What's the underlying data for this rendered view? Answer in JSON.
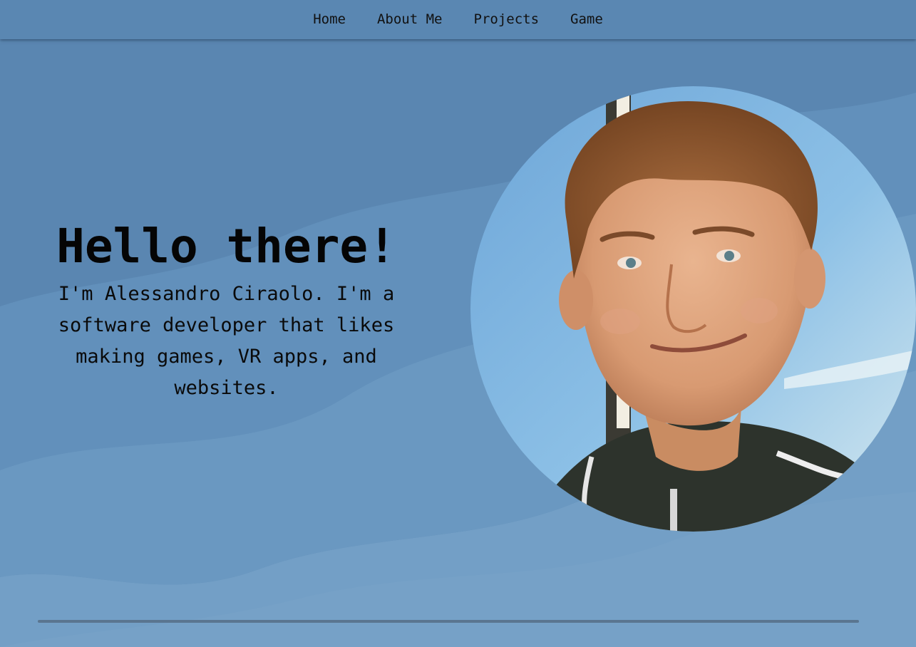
{
  "nav": {
    "items": [
      {
        "label": "Home"
      },
      {
        "label": "About Me"
      },
      {
        "label": "Projects"
      },
      {
        "label": "Game"
      }
    ]
  },
  "hero": {
    "title": "Hello there!",
    "subtitle": "I'm Alessandro Ciraolo. I'm a software developer that likes making games, VR apps, and websites."
  },
  "colors": {
    "navbar": "#5a87b2",
    "background": "#5f8db7",
    "text": "#050505"
  }
}
